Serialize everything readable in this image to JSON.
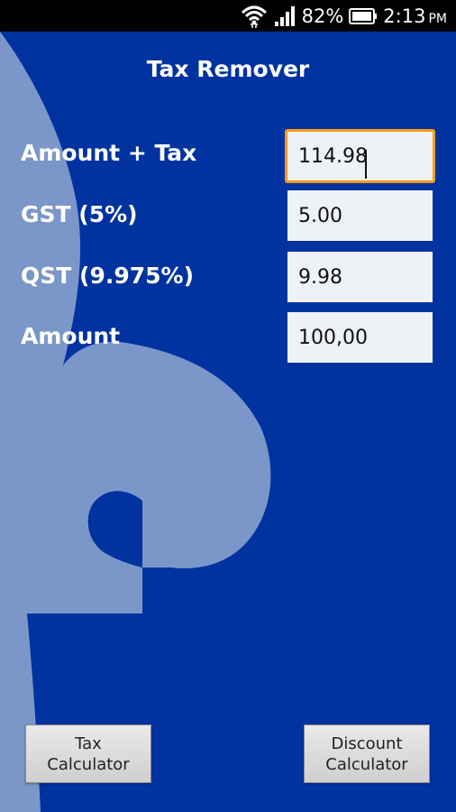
{
  "status_bar": {
    "battery": "82%",
    "time": "2:13",
    "ampm": "PM"
  },
  "app": {
    "title": "Tax Remover"
  },
  "form": {
    "rows": [
      {
        "label": "Amount + Tax",
        "value": "114.98"
      },
      {
        "label": "GST (5%)",
        "value": "5.00"
      },
      {
        "label": "QST (9.975%)",
        "value": "9.98"
      },
      {
        "label": "Amount",
        "value": "100,00"
      }
    ]
  },
  "buttons": {
    "tax_calculator": {
      "line1": "Tax",
      "line2": "Calculator"
    },
    "discount_calculator": {
      "line1": "Discount",
      "line2": "Calculator"
    }
  },
  "colors": {
    "background": "#0033a0",
    "fleur": "#7b97c9",
    "focus": "#ff9b1a",
    "field": "#eef1f6"
  },
  "icons": [
    "wifi-icon",
    "signal-icon",
    "battery-icon",
    "fleur-de-lis-icon"
  ]
}
